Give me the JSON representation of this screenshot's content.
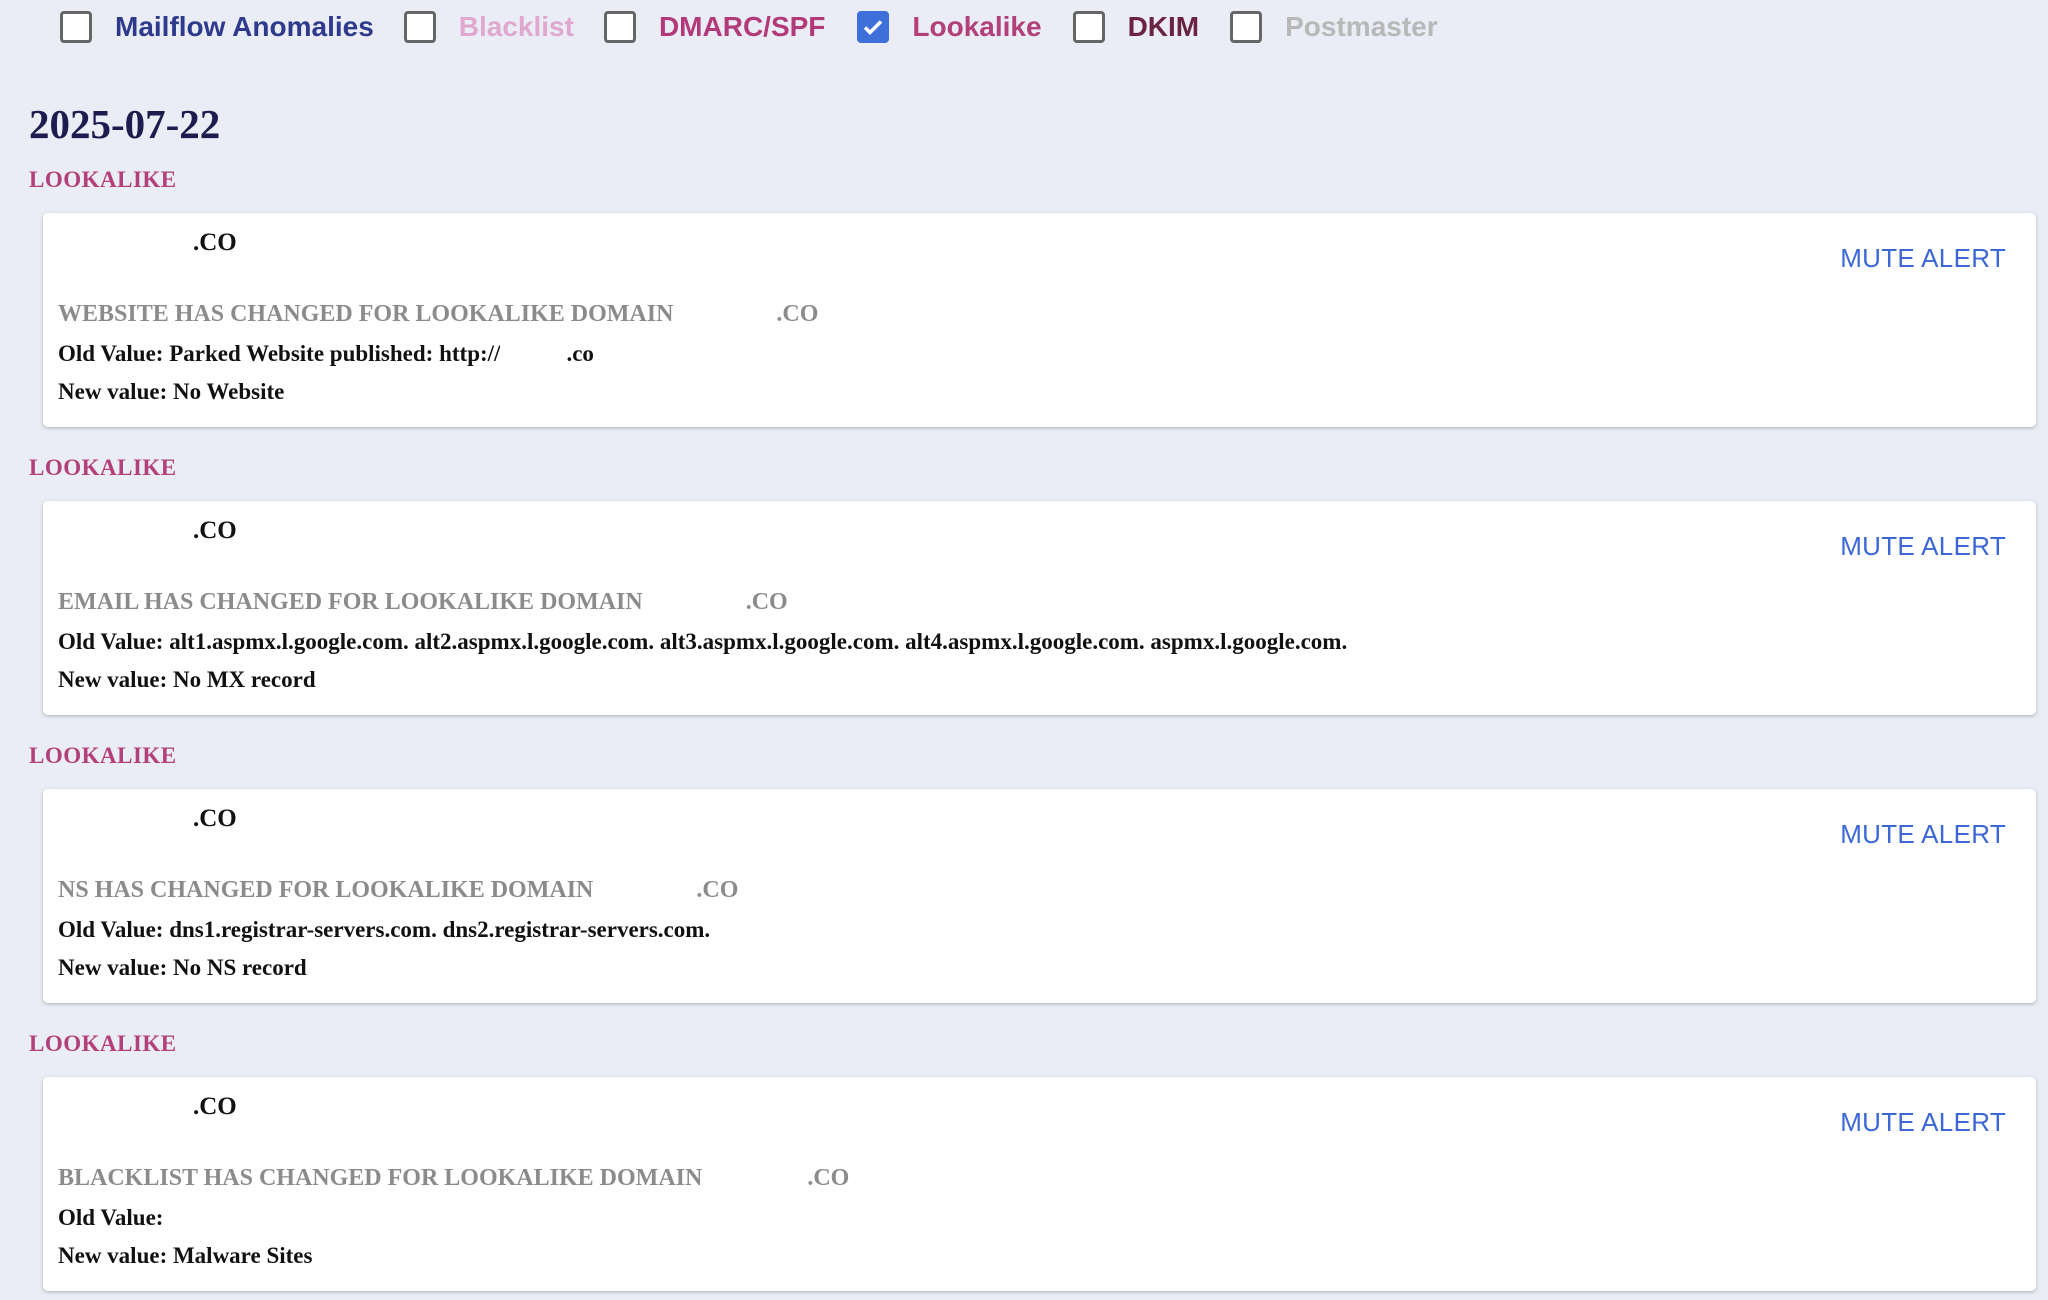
{
  "filters": [
    {
      "label": "Mailflow Anomalies",
      "checked": false,
      "color": "#2e3a8c"
    },
    {
      "label": "Blacklist",
      "checked": false,
      "color": "#e0a8cf"
    },
    {
      "label": "DMARC/SPF",
      "checked": false,
      "color": "#b23a7a"
    },
    {
      "label": "Lookalike",
      "checked": true,
      "color": "#b2407a"
    },
    {
      "label": "DKIM",
      "checked": false,
      "color": "#6b2344"
    },
    {
      "label": "Postmaster",
      "checked": false,
      "color": "#b8b8b8"
    }
  ],
  "date": "2025-07-22",
  "colors": {
    "category": "#b2407a",
    "mute": "#3c67d6",
    "title": "#8b8b8b"
  },
  "alerts": [
    {
      "category": "LOOKALIKE",
      "domain_tld": ".CO",
      "mute_label": "MUTE ALERT",
      "title_prefix": "WEBSITE HAS CHANGED FOR LOOKALIKE DOMAIN",
      "title_suffix": ".CO",
      "old_value": "Old Value: Parked Website published: http://",
      "old_value_tail": ".co",
      "new_value": "New value: No Website"
    },
    {
      "category": "LOOKALIKE",
      "domain_tld": ".CO",
      "mute_label": "MUTE ALERT",
      "title_prefix": "EMAIL HAS CHANGED FOR LOOKALIKE DOMAIN",
      "title_suffix": ".CO",
      "old_value": "Old Value: alt1.aspmx.l.google.com. alt2.aspmx.l.google.com. alt3.aspmx.l.google.com. alt4.aspmx.l.google.com. aspmx.l.google.com.",
      "old_value_tail": "",
      "new_value": "New value: No MX record"
    },
    {
      "category": "LOOKALIKE",
      "domain_tld": ".CO",
      "mute_label": "MUTE ALERT",
      "title_prefix": "NS HAS CHANGED FOR LOOKALIKE DOMAIN",
      "title_suffix": ".CO",
      "old_value": "Old Value: dns1.registrar-servers.com. dns2.registrar-servers.com.",
      "old_value_tail": "",
      "new_value": "New value: No NS record"
    },
    {
      "category": "LOOKALIKE",
      "domain_tld": ".CO",
      "mute_label": "MUTE ALERT",
      "title_prefix": "BLACKLIST HAS CHANGED FOR LOOKALIKE DOMAIN",
      "title_suffix": ".CO",
      "old_value": "Old Value:",
      "old_value_tail": "",
      "new_value": "New value: Malware Sites"
    }
  ]
}
